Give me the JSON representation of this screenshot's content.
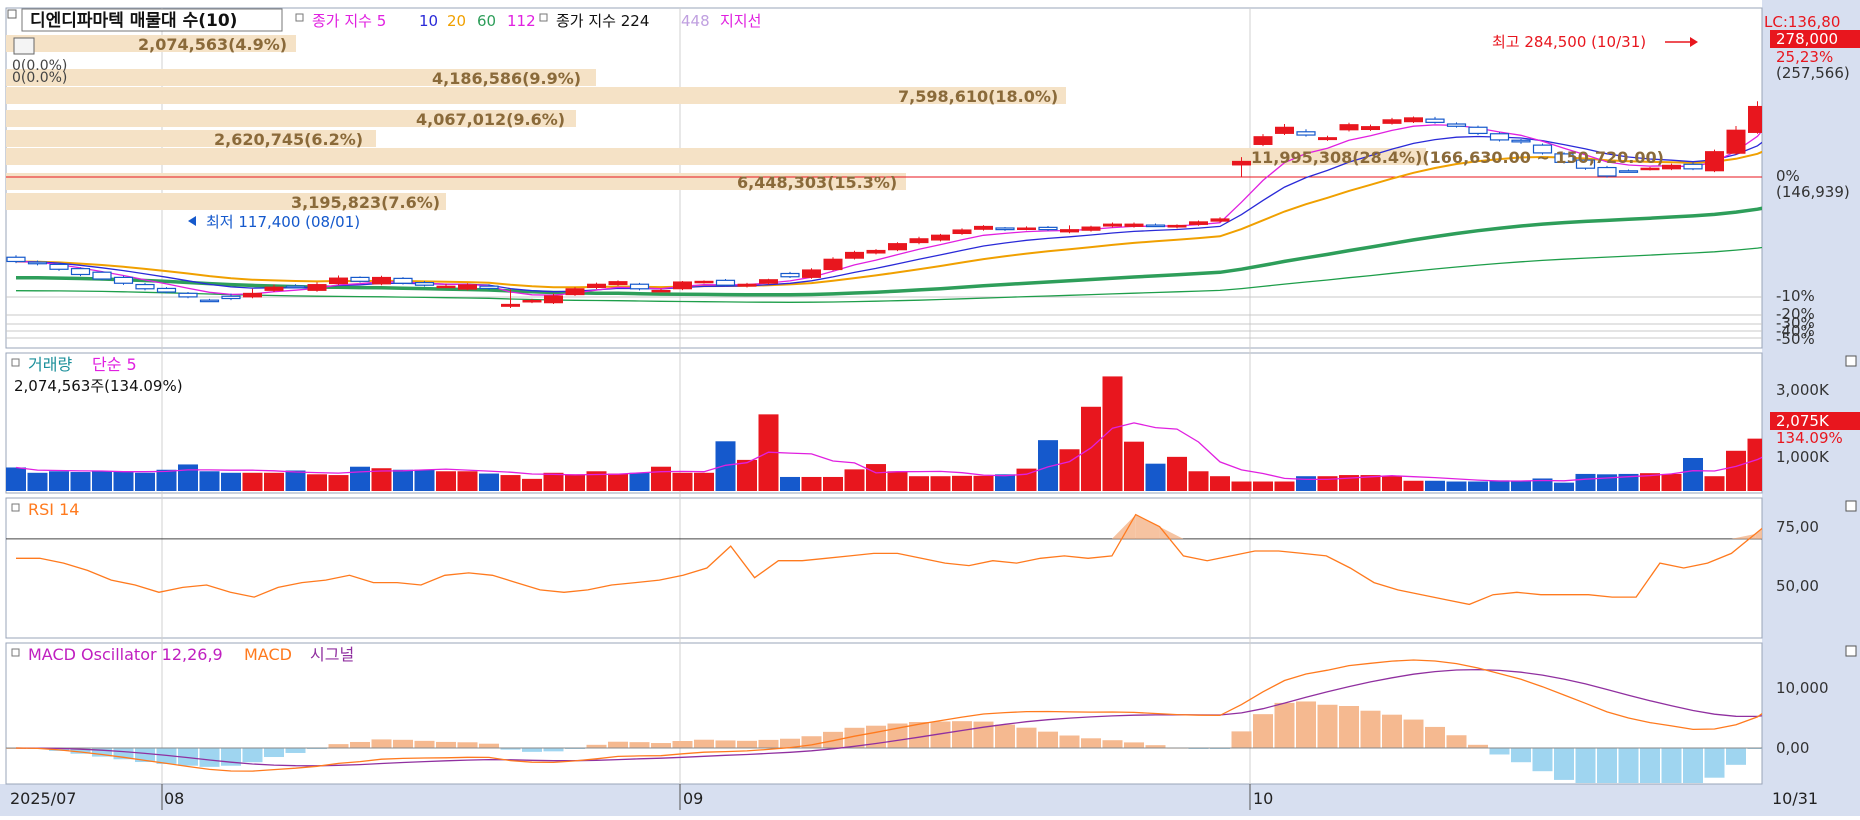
{
  "window": {
    "title": "디엔디파마텍 매물대 수(10)",
    "x_range_label": "10/31"
  },
  "price_panel": {
    "legend_ma_label": "종가 지수 5",
    "legend_ma_periods": [
      "10",
      "20",
      "60",
      "112"
    ],
    "legend_long_ma_label": "종가 지수 224",
    "legend_long_ma_extra": "448",
    "legend_support_label": "지지선",
    "lc_label": "LC:136,80",
    "current_price_badge": "278,000",
    "current_change_pct": "25,23%",
    "prev_value_paren": "(257,566)",
    "zero_pct_label": "0%",
    "zero_pct_value": "(146,939)",
    "pct_labels": [
      "-10%",
      "-20%",
      "-30%",
      "-40%",
      "-50%"
    ],
    "high_annotation": "최고 284,500 (10/31)",
    "low_annotation": "최저 117,400 (08/01)",
    "left_small_labels": [
      "0(0.0%)",
      "0(0.0%)"
    ],
    "volume_profile": [
      {
        "label": "2,074,563(4.9%)"
      },
      {
        "label": "4,186,586(9.9%)"
      },
      {
        "label": "7,598,610(18.0%)"
      },
      {
        "label": "4,067,012(9.6%)"
      },
      {
        "label": "2,620,745(6.2%)"
      },
      {
        "label": "11,995,308(28.4%)(166,630.00 ~ 150,720.00)"
      },
      {
        "label": "6,448,303(15.3%)"
      },
      {
        "label": "3,195,823(7.6%)"
      }
    ]
  },
  "volume_panel": {
    "title": "거래량",
    "ma_label": "단순 5",
    "last_volume_text": "2,074,563주(134.09%)",
    "axis_labels": [
      "3,000K",
      "1,000K"
    ],
    "last_badge": "2,075K",
    "last_ratio": "134.09%"
  },
  "rsi_panel": {
    "title": "RSI 14",
    "axis_labels": [
      "75,00",
      "50,00"
    ]
  },
  "macd_panel": {
    "osc_label": "MACD Oscillator 12,26,9",
    "macd_label": "MACD",
    "signal_label": "시그널",
    "axis_labels": [
      "10,000",
      "0,00"
    ]
  },
  "x_axis": {
    "labels": [
      "2025/07",
      "08",
      "09",
      "10"
    ]
  },
  "colors": {
    "up": "#e8161e",
    "down": "#1559cc",
    "ma5": "#e020e0",
    "ma10": "#2a2ad8",
    "ma20": "#f0a000",
    "ma60": "#2e9e5a",
    "ma224": "#e020e0",
    "long_ma": "#000000",
    "rsi": "#ff7a1e",
    "macd": "#ff7a1e",
    "signal": "#9030a0",
    "osc_pos": "#f5b990",
    "osc_neg": "#9fd5f0",
    "profile": "#f5e2c6"
  },
  "chart_data": [
    {
      "type": "candlestick",
      "title": "디엔디파마텍 매물대 수(10)",
      "x": [
        "07/01",
        "07/02",
        "07/03",
        "07/04",
        "07/07",
        "07/08",
        "07/09",
        "07/10",
        "07/11",
        "07/14",
        "07/15",
        "07/16",
        "07/17",
        "07/18",
        "07/21",
        "07/22",
        "07/23",
        "07/24",
        "07/25",
        "07/28",
        "07/29",
        "07/30",
        "07/31",
        "08/01",
        "08/04",
        "08/05",
        "08/06",
        "08/07",
        "08/08",
        "08/11",
        "08/12",
        "08/13",
        "08/14",
        "08/18",
        "08/19",
        "08/20",
        "08/21",
        "08/22",
        "08/25",
        "08/26",
        "08/27",
        "08/28",
        "08/29",
        "09/01",
        "09/02",
        "09/03",
        "09/04",
        "09/05",
        "09/08",
        "09/09",
        "09/10",
        "09/11",
        "09/12",
        "09/15",
        "09/16",
        "09/17",
        "09/18",
        "09/19",
        "09/22",
        "09/23",
        "09/24",
        "09/25",
        "09/26",
        "09/29",
        "09/30",
        "10/01",
        "10/02",
        "10/10",
        "10/13",
        "10/14",
        "10/15",
        "10/16",
        "10/17",
        "10/20",
        "10/21",
        "10/22",
        "10/23",
        "10/24",
        "10/27",
        "10/28",
        "10/29",
        "10/30",
        "10/31"
      ],
      "open": [
        142000,
        140500,
        139800,
        138500,
        137400,
        135800,
        133600,
        132400,
        130900,
        128800,
        130000,
        129800,
        131800,
        133100,
        131800,
        133900,
        135800,
        133800,
        135500,
        134200,
        133000,
        132200,
        133100,
        126900,
        128400,
        128000,
        130500,
        132700,
        133600,
        133700,
        131800,
        132300,
        134300,
        134900,
        133100,
        134000,
        137000,
        135800,
        138200,
        141700,
        143300,
        144300,
        146500,
        147300,
        149300,
        150600,
        151000,
        150700,
        151200,
        149800,
        150300,
        151600,
        151500,
        151900,
        151300,
        152100,
        153100,
        170400,
        176700,
        180100,
        180600,
        178200,
        181200,
        181300,
        183200,
        183700,
        184500,
        183000,
        182000,
        180000,
        178000,
        176500,
        173800,
        171900,
        169600,
        168600,
        169200,
        169200,
        170600,
        168600,
        174000,
        180400,
        188500
      ],
      "close": [
        140700,
        140000,
        138300,
        136700,
        135300,
        134000,
        132300,
        131300,
        129800,
        128700,
        129300,
        130900,
        132800,
        132800,
        133600,
        135600,
        134600,
        135800,
        134000,
        133400,
        133100,
        133500,
        132400,
        127500,
        128700,
        130100,
        132300,
        133700,
        134500,
        132300,
        131800,
        134400,
        134600,
        133400,
        133700,
        135100,
        136000,
        138100,
        141400,
        143500,
        144100,
        146200,
        147700,
        148800,
        150400,
        151500,
        150500,
        151000,
        150500,
        150500,
        151300,
        152200,
        152200,
        151700,
        151800,
        152900,
        153800,
        171500,
        179100,
        182000,
        179600,
        178800,
        182800,
        182200,
        184300,
        184900,
        183500,
        182300,
        180100,
        178100,
        177500,
        174100,
        171200,
        169400,
        167000,
        168500,
        169400,
        170300,
        169200,
        174500,
        181100,
        188400,
        203200
      ],
      "high": [
        142600,
        141000,
        140300,
        138900,
        137700,
        136300,
        134100,
        132800,
        131300,
        129200,
        130800,
        132300,
        133600,
        133700,
        134300,
        136400,
        136100,
        136300,
        135900,
        134700,
        133900,
        134000,
        133700,
        132200,
        129200,
        130800,
        132800,
        134200,
        134900,
        134100,
        132300,
        134700,
        134900,
        135300,
        134100,
        135400,
        137500,
        138600,
        142000,
        144000,
        144500,
        146600,
        148300,
        149200,
        150900,
        151900,
        151300,
        151500,
        151600,
        151800,
        151700,
        152700,
        152700,
        152400,
        152100,
        153300,
        154300,
        172800,
        179900,
        183000,
        181400,
        179400,
        183400,
        182800,
        184900,
        185300,
        185200,
        183500,
        182500,
        180500,
        178400,
        177000,
        174300,
        172300,
        170100,
        169000,
        169800,
        170800,
        171100,
        175100,
        182400,
        190000,
        208500
      ],
      "low": [
        140200,
        139500,
        137800,
        136200,
        134900,
        133500,
        131800,
        130900,
        129400,
        128300,
        128800,
        129400,
        131300,
        132400,
        131400,
        133500,
        134200,
        133400,
        133600,
        133000,
        132600,
        131800,
        131900,
        126400,
        127900,
        127600,
        130100,
        132200,
        133200,
        131800,
        131300,
        131900,
        133900,
        133000,
        132700,
        133600,
        135600,
        135400,
        137900,
        141300,
        142900,
        143900,
        146000,
        146900,
        148900,
        150200,
        150100,
        150300,
        150100,
        149400,
        149900,
        151200,
        151100,
        151500,
        150900,
        151700,
        152700,
        166800,
        176200,
        179600,
        179100,
        177800,
        180700,
        180900,
        182800,
        183300,
        183100,
        181900,
        179600,
        177600,
        176900,
        173600,
        170800,
        168900,
        166500,
        168100,
        168700,
        168800,
        168800,
        168200,
        173500,
        180000,
        188000
      ],
      "xlabel": "",
      "ylabel": "",
      "ylim": [
        115000,
        215000
      ],
      "annotations": {
        "high": "최고 284,500 (10/31)",
        "low": "최저 117,400 (08/01)",
        "last": "278,000"
      }
    },
    {
      "type": "line",
      "series": [
        {
          "name": "5",
          "values_ref": "close"
        },
        {
          "name": "10",
          "values_ref": "close"
        },
        {
          "name": "20",
          "values_ref": "close"
        },
        {
          "name": "60",
          "values_ref": "close"
        },
        {
          "name": "112",
          "values_ref": "close"
        },
        {
          "name": "224",
          "start": 83000,
          "end": 101000
        },
        {
          "name": "448",
          "start": 54000,
          "end": 87000
        }
      ]
    },
    {
      "type": "bar",
      "title": "거래량",
      "values": [
        620,
        480,
        520,
        500,
        520,
        520,
        480,
        560,
        700,
        520,
        480,
        480,
        480,
        540,
        440,
        420,
        640,
        600,
        560,
        560,
        520,
        520,
        460,
        420,
        320,
        480,
        440,
        520,
        460,
        480,
        640,
        480,
        480,
        1310,
        820,
        2020,
        370,
        370,
        370,
        570,
        710,
        520,
        390,
        390,
        400,
        400,
        440,
        590,
        1340,
        1100,
        2220,
        3020,
        1300,
        720,
        900,
        520,
        390,
        250,
        250,
        250,
        390,
        390,
        420,
        420,
        390,
        270,
        270,
        250,
        250,
        280,
        270,
        330,
        220,
        450,
        440,
        450,
        470,
        450,
        870,
        390,
        1060,
        1380,
        1780
      ],
      "volume_ma5_ref": "values",
      "ylim": [
        0,
        3400
      ]
    },
    {
      "type": "line",
      "title": "RSI 14",
      "series": [
        {
          "name": "RSI 14",
          "values": [
            62,
            62,
            60,
            57,
            53,
            51,
            48,
            50,
            51,
            48,
            46,
            50,
            52,
            53,
            55,
            52,
            52,
            51,
            55,
            56,
            55,
            52,
            49,
            48,
            49,
            51,
            52,
            53,
            55,
            58,
            67,
            54,
            61,
            61,
            62,
            63,
            64,
            64,
            62,
            60,
            59,
            61,
            60,
            62,
            63,
            62,
            63,
            80,
            75,
            63,
            61,
            63,
            65,
            65,
            64,
            63,
            58,
            52,
            49,
            47,
            45,
            43,
            47,
            48,
            47,
            47,
            47,
            46,
            46,
            60,
            58,
            60,
            64,
            72,
            80
          ]
        }
      ],
      "ylim": [
        30,
        86
      ],
      "reference_lines": [
        70
      ]
    },
    {
      "type": "bar",
      "title": "MACD Oscillator 12,26,9",
      "series_names": [
        "MACD",
        "시그널"
      ]
    }
  ]
}
